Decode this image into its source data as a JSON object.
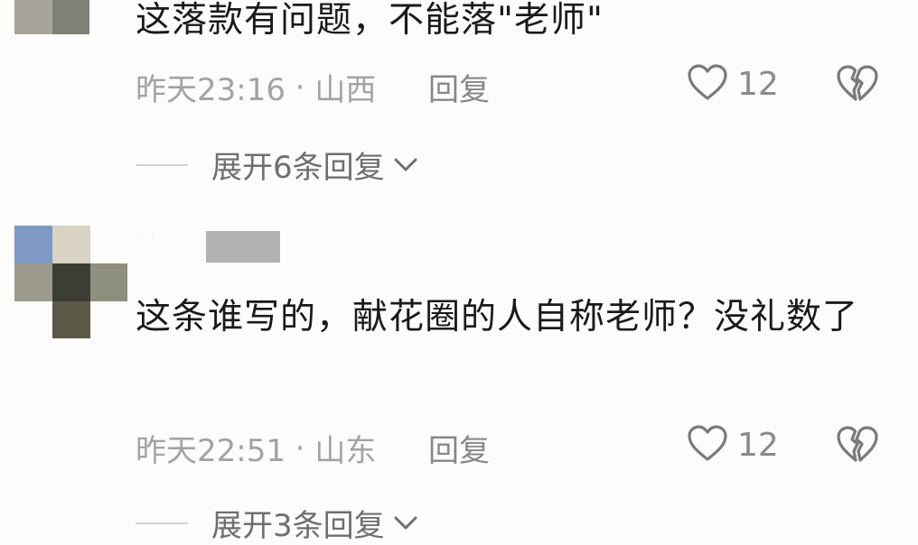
{
  "comments": [
    {
      "text": "这落款有问题，不能落\"老师\"",
      "time": "昨天23:16",
      "separator": " · ",
      "location": "山西",
      "reply_label": "回复",
      "likes": "12",
      "expand_label": "展开6条回复"
    },
    {
      "text": "这条谁写的，献花圈的人自称老师？没礼数了",
      "time": "昨天22:51",
      "separator": " · ",
      "location": "山东",
      "reply_label": "回复",
      "likes": "12",
      "expand_label": "展开3条回复"
    }
  ],
  "icons": {
    "like": "heart-outline-icon",
    "dislike": "broken-heart-icon",
    "expand": "chevron-down-icon"
  },
  "colors": {
    "background": "#fcfcfa",
    "text": "#1a1a1a",
    "meta": "#a3a3a3",
    "icon": "#7a7a7a"
  }
}
